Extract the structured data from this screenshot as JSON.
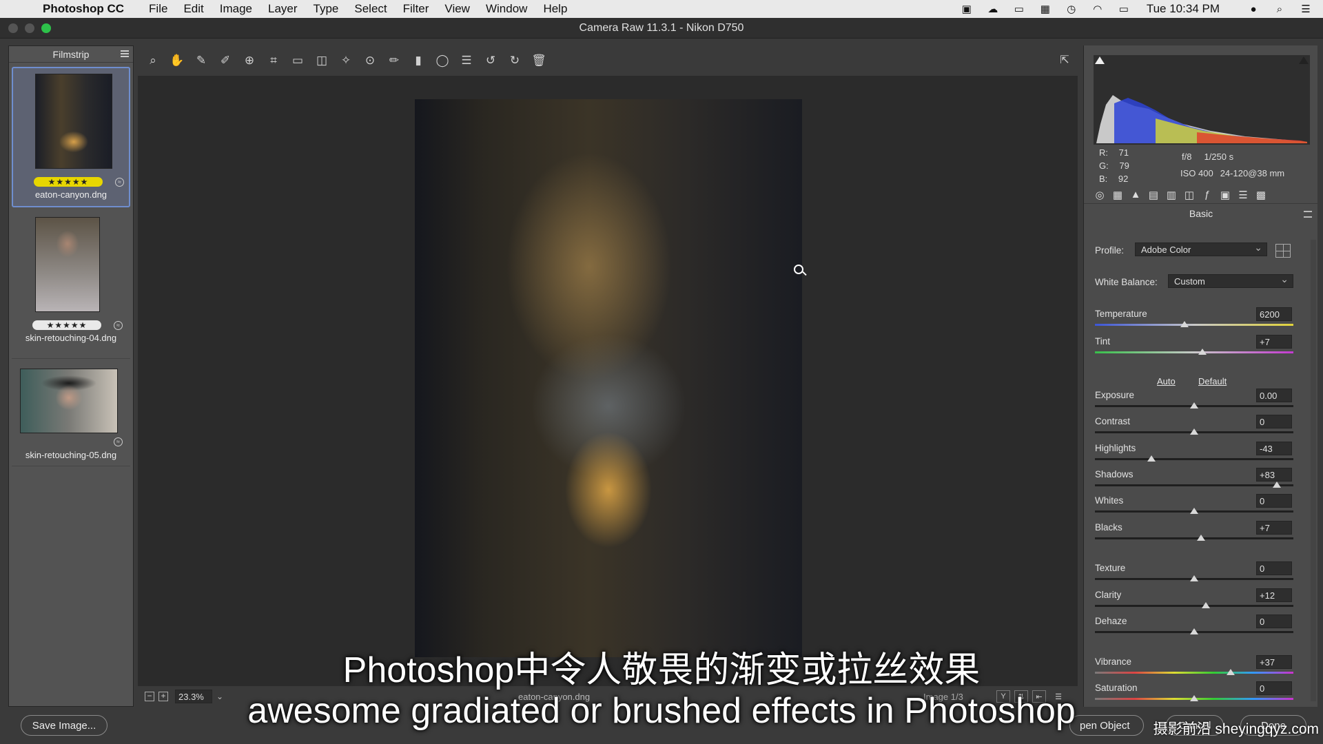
{
  "menubar": {
    "app_name": "Photoshop CC",
    "items": [
      "File",
      "Edit",
      "Image",
      "Layer",
      "Type",
      "Select",
      "Filter",
      "View",
      "Window",
      "Help"
    ],
    "clock": "Tue 10:34 PM"
  },
  "window": {
    "title": "Camera Raw 11.3.1  -  Nikon D750"
  },
  "filmstrip": {
    "title": "Filmstrip",
    "items": [
      {
        "filename": "eaton-canyon.dng",
        "stars": "★★★★★"
      },
      {
        "filename": "skin-retouching-04.dng",
        "stars": "★★★★★"
      },
      {
        "filename": "skin-retouching-05.dng"
      }
    ]
  },
  "status": {
    "zoom": "23.3%",
    "filename": "eaton-canyon.dng",
    "image_counter": "Image 1/3"
  },
  "readout": {
    "r_label": "R:",
    "r": "71",
    "g_label": "G:",
    "g": "79",
    "b_label": "B:",
    "b": "92",
    "aperture": "f/8",
    "shutter": "1/250 s",
    "iso": "ISO 400",
    "lens": "24-120@38 mm"
  },
  "panel": {
    "section": "Basic",
    "profile_label": "Profile:",
    "profile_value": "Adobe Color",
    "wb_label": "White Balance:",
    "wb_value": "Custom",
    "auto": "Auto",
    "default": "Default",
    "sliders": [
      {
        "label": "Temperature",
        "value": "6200",
        "pos": 0.45,
        "track": "temp"
      },
      {
        "label": "Tint",
        "value": "+7",
        "pos": 0.54,
        "track": "tint"
      },
      {
        "label": "Exposure",
        "value": "0.00",
        "pos": 0.5
      },
      {
        "label": "Contrast",
        "value": "0",
        "pos": 0.5
      },
      {
        "label": "Highlights",
        "value": "-43",
        "pos": 0.285
      },
      {
        "label": "Shadows",
        "value": "+83",
        "pos": 0.915
      },
      {
        "label": "Whites",
        "value": "0",
        "pos": 0.5
      },
      {
        "label": "Blacks",
        "value": "+7",
        "pos": 0.535
      },
      {
        "label": "Texture",
        "value": "0",
        "pos": 0.5
      },
      {
        "label": "Clarity",
        "value": "+12",
        "pos": 0.56
      },
      {
        "label": "Dehaze",
        "value": "0",
        "pos": 0.5
      },
      {
        "label": "Vibrance",
        "value": "+37",
        "pos": 0.685,
        "track": "vib"
      },
      {
        "label": "Saturation",
        "value": "0",
        "pos": 0.5,
        "track": "sat"
      }
    ]
  },
  "buttons": {
    "save_image": "Save Image...",
    "open_object": "pen Object",
    "cancel": "Cancel",
    "done": "Done"
  },
  "overlay": {
    "caption_cn": "Photoshop中令人敬畏的渐变或拉丝效果",
    "caption_en": "awesome gradiated or brushed effects in Photoshop",
    "watermark": "摄影前沿 sheyingqyz.com"
  },
  "colors": {
    "selection_border": "#6f8ecf",
    "star_gold": "#e7d600",
    "panel_bg": "#4b4b4b"
  }
}
